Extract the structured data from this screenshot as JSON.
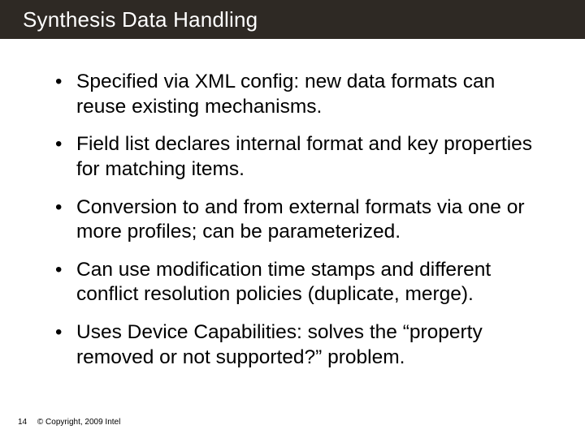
{
  "title": "Synthesis Data Handling",
  "bullets": [
    "Specified via XML config: new data formats can reuse existing mechanisms.",
    "Field list declares internal format and key properties for matching items.",
    "Conversion to and from external formats via one or more profiles; can be parameterized.",
    "Can use modification time stamps and different conflict resolution policies (duplicate, merge).",
    "Uses Device Capabilities: solves the “property removed or not supported?” problem."
  ],
  "footer": {
    "page": "14",
    "copyright": "© Copyright, 2009 Intel"
  }
}
